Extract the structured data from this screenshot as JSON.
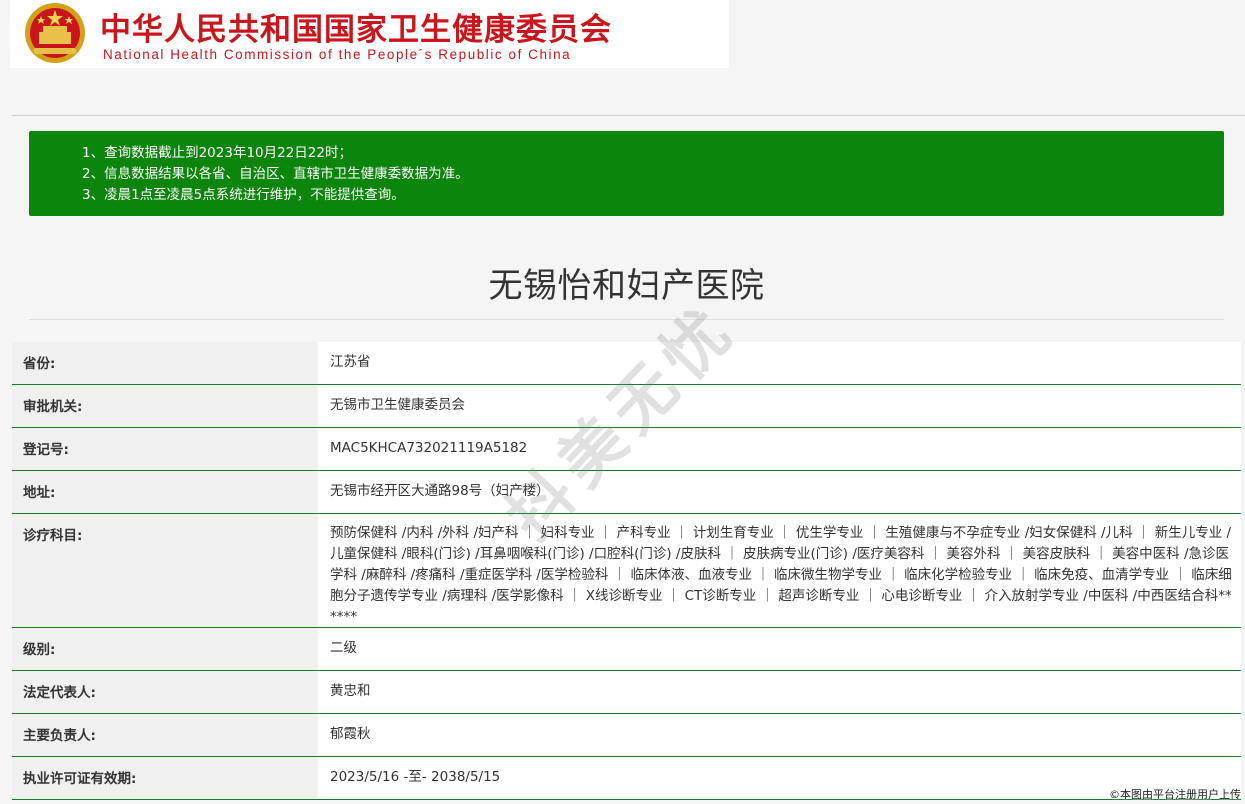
{
  "header": {
    "title_cn": "中华人民共和国国家卫生健康委员会",
    "title_en": "National Health Commission of the People´s Republic of China",
    "emblem_icon": "national-emblem-icon",
    "brand_color": "#c9161d"
  },
  "notice": {
    "lines": [
      "1、查询数据截止到2023年10月22日22时；",
      "2、信息数据结果以各省、自治区、直辖市卫生健康委数据为准。",
      "3、凌晨1点至凌晨5点系统进行维护，不能提供查询。"
    ],
    "background_color": "#0b850b"
  },
  "hospital": {
    "name": "无锡怡和妇产医院"
  },
  "rows": [
    {
      "label": "省份:",
      "value": "江苏省"
    },
    {
      "label": "审批机关:",
      "value": "无锡市卫生健康委员会"
    },
    {
      "label": "登记号:",
      "value": "MAC5KHCA732021119A5182"
    },
    {
      "label": "地址:",
      "value": "无锡市经开区大通路98号（妇产楼）"
    },
    {
      "label": "诊疗科目:",
      "value": "预防保健科 /内科 /外科 /妇产科 ｜ 妇科专业 ｜ 产科专业 ｜ 计划生育专业 ｜ 优生学专业 ｜ 生殖健康与不孕症专业 /妇女保健科 /儿科 ｜ 新生儿专业 /儿童保健科 /眼科(门诊) /耳鼻咽喉科(门诊) /口腔科(门诊) /皮肤科 ｜ 皮肤病专业(门诊) /医疗美容科 ｜ 美容外科 ｜ 美容皮肤科 ｜ 美容中医科 /急诊医学科 /麻醉科 /疼痛科 /重症医学科 /医学检验科 ｜ 临床体液、血液专业 ｜ 临床微生物学专业 ｜ 临床化学检验专业 ｜ 临床免疫、血清学专业 ｜ 临床细胞分子遗传学专业 /病理科 /医学影像科 ｜ X线诊断专业 ｜ CT诊断专业 ｜ 超声诊断专业 ｜ 心电诊断专业 ｜ 介入放射学专业 /中医科 /中西医结合科******"
    },
    {
      "label": "级别:",
      "value": "二级"
    },
    {
      "label": "法定代表人:",
      "value": "黄忠和"
    },
    {
      "label": "主要负责人:",
      "value": "郁霞秋"
    },
    {
      "label": "执业许可证有效期:",
      "value": "2023/5/16 -至- 2038/5/15"
    }
  ],
  "watermark": "抖美无忧",
  "credit": "©本图由平台注册用户上传"
}
